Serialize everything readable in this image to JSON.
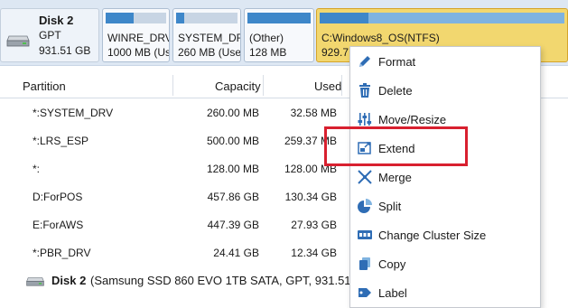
{
  "disk_map": {
    "disk": {
      "name": "Disk 2",
      "type": "GPT",
      "size": "931.51 GB",
      "icon": "hard-disk-icon"
    },
    "partitions": [
      {
        "name": "WINRE_DRV",
        "size": "1000 MB (Us",
        "used_fraction": 0.46
      },
      {
        "name": "SYSTEM_DR",
        "size": "260 MB (Use",
        "used_fraction": 0.13
      },
      {
        "name": "(Other)",
        "size": "128 MB",
        "used_fraction": 1.0
      },
      {
        "name": "C:Windows8_OS(NTFS)",
        "size": "929.7",
        "used_fraction": 0.2,
        "selected": true
      }
    ]
  },
  "table": {
    "headers": {
      "partition": "Partition",
      "capacity": "Capacity",
      "used": "Used"
    },
    "rows": [
      {
        "partition": "*:SYSTEM_DRV",
        "capacity": "260.00 MB",
        "used": "32.58 MB"
      },
      {
        "partition": "*:LRS_ESP",
        "capacity": "500.00 MB",
        "used": "259.37 MB"
      },
      {
        "partition": "*:",
        "capacity": "128.00 MB",
        "used": "128.00 MB"
      },
      {
        "partition": "D:ForPOS",
        "capacity": "457.86 GB",
        "used": "130.34 GB"
      },
      {
        "partition": "E:ForAWS",
        "capacity": "447.39 GB",
        "used": "27.93 GB"
      },
      {
        "partition": "*:PBR_DRV",
        "capacity": "24.41 GB",
        "used": "12.34 GB"
      }
    ],
    "disk_row": {
      "name": "Disk 2",
      "description": "(Samsung SSD 860 EVO 1TB SATA, GPT, 931.51 G"
    }
  },
  "context_menu": {
    "items": [
      {
        "label": "Format",
        "icon": "pencil-icon"
      },
      {
        "label": "Delete",
        "icon": "trash-icon"
      },
      {
        "label": "Move/Resize",
        "icon": "sliders-icon"
      },
      {
        "label": "Extend",
        "icon": "extend-icon"
      },
      {
        "label": "Merge",
        "icon": "merge-icon"
      },
      {
        "label": "Split",
        "icon": "pie-split-icon"
      },
      {
        "label": "Change Cluster Size",
        "icon": "cluster-size-icon"
      },
      {
        "label": "Copy",
        "icon": "copy-icon"
      },
      {
        "label": "Label",
        "icon": "label-icon"
      }
    ]
  },
  "colors": {
    "accent": "#2f6db5",
    "selected_partition": "#f2d76f",
    "used_bar": "#3e87c9",
    "highlight": "#d8202f"
  }
}
